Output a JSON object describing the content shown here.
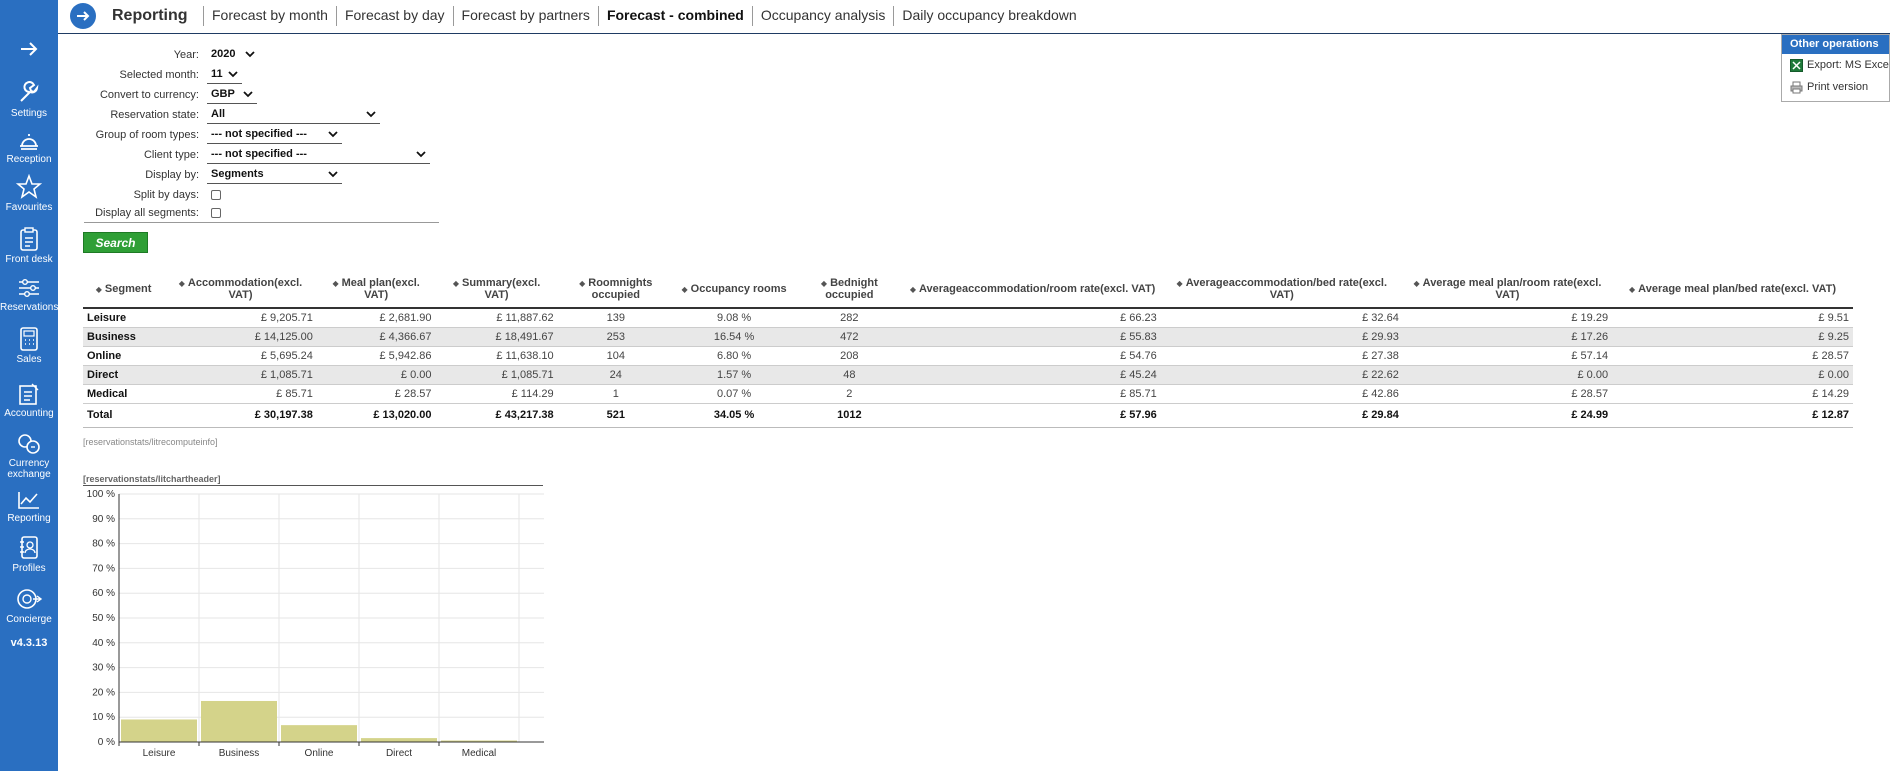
{
  "sidebar": {
    "items": [
      {
        "label": "Settings",
        "icon": "wrench-icon"
      },
      {
        "label": "Reception",
        "icon": "bell-icon"
      },
      {
        "label": "Favourites",
        "icon": "star-icon"
      },
      {
        "label": "Front desk",
        "icon": "clipboard-icon"
      },
      {
        "label": "Reservations",
        "icon": "sliders-icon"
      },
      {
        "label": "Sales",
        "icon": "calculator-icon"
      },
      {
        "label": "Accounting",
        "icon": "ledger-icon"
      },
      {
        "label": "Currency exchange",
        "icon": "coins-icon"
      },
      {
        "label": "Reporting",
        "icon": "chart-icon"
      },
      {
        "label": "Profiles",
        "icon": "address-book-icon"
      },
      {
        "label": "Concierge",
        "icon": "concierge-icon"
      }
    ],
    "version": "v4.3.13"
  },
  "header": {
    "title": "Reporting",
    "tabs": [
      {
        "label": "Forecast by month"
      },
      {
        "label": "Forecast by day"
      },
      {
        "label": "Forecast by partners"
      },
      {
        "label": "Forecast - combined",
        "active": true
      },
      {
        "label": "Occupancy analysis"
      },
      {
        "label": "Daily occupancy breakdown"
      }
    ]
  },
  "other_operations": {
    "title": "Other operations",
    "items": [
      {
        "label": "Export: MS Excel",
        "icon": "excel-icon"
      },
      {
        "label": "Print version",
        "icon": "printer-icon"
      }
    ]
  },
  "filters": {
    "year": {
      "label": "Year:",
      "value": "2020"
    },
    "month": {
      "label": "Selected month:",
      "value": "11"
    },
    "currency": {
      "label": "Convert to currency:",
      "value": "GBP"
    },
    "reservation_state": {
      "label": "Reservation state:",
      "value": "All"
    },
    "room_group": {
      "label": "Group of room types:",
      "value": "--- not specified ---"
    },
    "client_type": {
      "label": "Client type:",
      "value": "--- not specified ---"
    },
    "display_by": {
      "label": "Display by:",
      "value": "Segments"
    },
    "split_by_days": {
      "label": "Split by days:",
      "checked": false
    },
    "display_all_segments": {
      "label": "Display all segments:",
      "checked": false
    }
  },
  "search_label": "Search",
  "table": {
    "headers": [
      "Segment",
      "Accommodation(excl. VAT)",
      "Meal plan(excl. VAT)",
      "Summary(excl. VAT)",
      "Roomnights occupied",
      "Occupancy rooms",
      "Bednight occupied",
      "Averageaccommodation/room rate(excl. VAT)",
      "Averageaccommodation/bed rate(excl. VAT)",
      "Average meal plan/room rate(excl. VAT)",
      "Average meal plan/bed rate(excl. VAT)"
    ],
    "rows": [
      [
        "Leisure",
        "£ 9,205.71",
        "£ 2,681.90",
        "£ 11,887.62",
        "139",
        "9.08 %",
        "282",
        "£ 66.23",
        "£ 32.64",
        "£ 19.29",
        "£ 9.51"
      ],
      [
        "Business",
        "£ 14,125.00",
        "£ 4,366.67",
        "£ 18,491.67",
        "253",
        "16.54 %",
        "472",
        "£ 55.83",
        "£ 29.93",
        "£ 17.26",
        "£ 9.25"
      ],
      [
        "Online",
        "£ 5,695.24",
        "£ 5,942.86",
        "£ 11,638.10",
        "104",
        "6.80 %",
        "208",
        "£ 54.76",
        "£ 27.38",
        "£ 57.14",
        "£ 28.57"
      ],
      [
        "Direct",
        "£ 1,085.71",
        "£ 0.00",
        "£ 1,085.71",
        "24",
        "1.57 %",
        "48",
        "£ 45.24",
        "£ 22.62",
        "£ 0.00",
        "£ 0.00"
      ],
      [
        "Medical",
        "£ 85.71",
        "£ 28.57",
        "£ 114.29",
        "1",
        "0.07 %",
        "2",
        "£ 85.71",
        "£ 42.86",
        "£ 28.57",
        "£ 14.29"
      ]
    ],
    "total": [
      "Total",
      "£ 30,197.38",
      "£ 13,020.00",
      "£ 43,217.38",
      "521",
      "34.05 %",
      "1012",
      "£ 57.96",
      "£ 29.84",
      "£ 24.99",
      "£ 12.87"
    ]
  },
  "compute_info": "[reservationstats/litrecomputeinfo]",
  "chart_header": "[reservationstats/litchartheader]",
  "chart_data": {
    "type": "bar",
    "title": "",
    "xlabel": "",
    "ylabel": "",
    "categories": [
      "Leisure",
      "Business",
      "Online",
      "Direct",
      "Medical"
    ],
    "values": [
      9.08,
      16.54,
      6.8,
      1.57,
      0.07
    ],
    "ylim": [
      0,
      100
    ],
    "yticks": [
      "0 %",
      "10 %",
      "20 %",
      "30 %",
      "40 %",
      "50 %",
      "60 %",
      "70 %",
      "80 %",
      "90 %",
      "100 %"
    ],
    "bar_color": "#d4d38a",
    "grid": true
  },
  "colors": {
    "sidebar": "#2a6fc1",
    "accent": "#2a6fc1",
    "search_button": "#2f9f36"
  }
}
